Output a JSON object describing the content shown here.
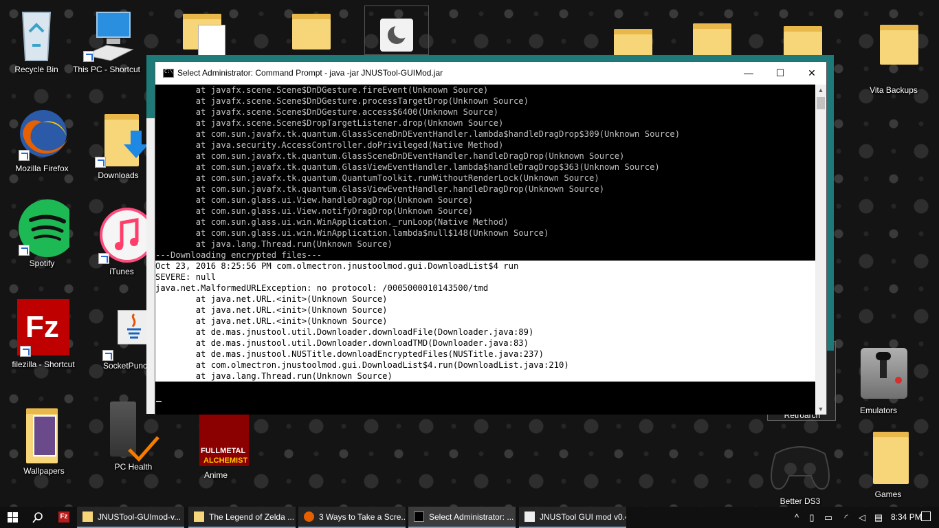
{
  "desktop": {
    "icons": {
      "recycle_bin": "Recycle Bin",
      "this_pc": "This PC - Shortcut",
      "firefox": "Mozilla Firefox",
      "downloads": "Downloads",
      "spotify": "Spotify",
      "itunes": "iTunes",
      "filezilla": "filezilla - Shortcut",
      "socketpunch": "SocketPunc",
      "wallpapers": "Wallpapers",
      "pc_health": "PC Health",
      "anime": "Anime",
      "vita_backups": "Vita Backups",
      "retroarch": "Retroarch",
      "emulators": "Emulators",
      "better_ds3": "Better DS3",
      "games": "Games"
    }
  },
  "window": {
    "title": "Select Administrator: Command Prompt - java  -jar JNUSTool-GUIMod.jar",
    "minimize": "—",
    "maximize": "☐",
    "close": "✕",
    "console_lines": [
      "        at javafx.scene.Scene$DnDGesture.fireEvent(Unknown Source)",
      "        at javafx.scene.Scene$DnDGesture.processTargetDrop(Unknown Source)",
      "        at javafx.scene.Scene$DnDGesture.access$6400(Unknown Source)",
      "        at javafx.scene.Scene$DropTargetListener.drop(Unknown Source)",
      "        at com.sun.javafx.tk.quantum.GlassSceneDnDEventHandler.lambda$handleDragDrop$309(Unknown Source)",
      "        at java.security.AccessController.doPrivileged(Native Method)",
      "        at com.sun.javafx.tk.quantum.GlassSceneDnDEventHandler.handleDragDrop(Unknown Source)",
      "        at com.sun.javafx.tk.quantum.GlassViewEventHandler.lambda$handleDragDrop$363(Unknown Source)",
      "        at com.sun.javafx.tk.quantum.QuantumToolkit.runWithoutRenderLock(Unknown Source)",
      "        at com.sun.javafx.tk.quantum.GlassViewEventHandler.handleDragDrop(Unknown Source)",
      "        at com.sun.glass.ui.View.handleDragDrop(Unknown Source)",
      "        at com.sun.glass.ui.View.notifyDragDrop(Unknown Source)",
      "        at com.sun.glass.ui.win.WinApplication._runLoop(Native Method)",
      "        at com.sun.glass.ui.win.WinApplication.lambda$null$148(Unknown Source)",
      "        at java.lang.Thread.run(Unknown Source)",
      "---Downloading encrypted files---"
    ],
    "selected_lines": [
      "Oct 23, 2016 8:25:56 PM com.olmectron.jnustoolmod.gui.DownloadList$4 run",
      "SEVERE: null",
      "java.net.MalformedURLException: no protocol: /0005000010143500/tmd",
      "        at java.net.URL.<init>(Unknown Source)",
      "        at java.net.URL.<init>(Unknown Source)",
      "        at java.net.URL.<init>(Unknown Source)",
      "        at de.mas.jnustool.util.Downloader.downloadFile(Downloader.java:89)",
      "        at de.mas.jnustool.util.Downloader.downloadTMD(Downloader.java:83)",
      "        at de.mas.jnustool.NUSTitle.downloadEncryptedFiles(NUSTitle.java:237)",
      "        at com.olmectron.jnustoolmod.gui.DownloadList$4.run(DownloadList.java:210)",
      "        at java.lang.Thread.run(Unknown Source)"
    ]
  },
  "taskbar": {
    "tasks": [
      {
        "label": "JNUSTool-GUImod-v..."
      },
      {
        "label": "The Legend of Zelda ..."
      },
      {
        "label": "3 Ways to Take a Scre..."
      },
      {
        "label": "Select Administrator: ..."
      },
      {
        "label": "JNUSTool GUI mod v0.4"
      }
    ],
    "clock": "8:34 PM"
  }
}
